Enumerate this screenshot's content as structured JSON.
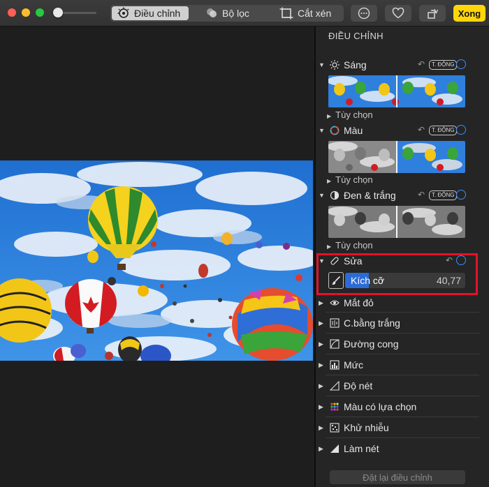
{
  "toolbar": {
    "tabs": [
      {
        "label": "Điều chỉnh",
        "icon": "adjust-dial-icon"
      },
      {
        "label": "Bộ lọc",
        "icon": "filters-circles-icon"
      },
      {
        "label": "Cắt xén",
        "icon": "crop-icon"
      }
    ],
    "more_icon": "ellipsis-icon",
    "favorite_icon": "heart-icon",
    "rotate_icon": "rotate-icon",
    "done_label": "Xong",
    "done_color": "#ffd60a"
  },
  "sidebar": {
    "title": "ĐIỀU CHỈNH",
    "sections": [
      {
        "label": "Sáng",
        "icon": "sun-icon",
        "auto": "T. ĐỘNG",
        "options": "Tùy chọn"
      },
      {
        "label": "Màu",
        "icon": "color-wheel-icon",
        "auto": "T. ĐỘNG",
        "options": "Tùy chọn"
      },
      {
        "label": "Đen & trắng",
        "icon": "half-circle-icon",
        "auto": "T. ĐỘNG",
        "options": "Tùy chọn"
      }
    ],
    "repair": {
      "label": "Sửa",
      "icon": "bandage-icon",
      "brush_icon": "brush-icon",
      "size_label": "Kích cỡ",
      "size_value": "40,77",
      "size_fraction": 0.2
    },
    "rows": [
      {
        "label": "Mắt đỏ",
        "icon": "eye-icon"
      },
      {
        "label": "C.bằng trắng",
        "icon": "white-balance-icon"
      },
      {
        "label": "Đường cong",
        "icon": "curves-icon"
      },
      {
        "label": "Mức",
        "icon": "levels-icon"
      },
      {
        "label": "Độ nét",
        "icon": "definition-icon"
      },
      {
        "label": "Màu có lựa chọn",
        "icon": "selective-color-icon"
      },
      {
        "label": "Khử nhiễu",
        "icon": "noise-reduction-icon"
      },
      {
        "label": "Làm nét",
        "icon": "sharpen-icon"
      }
    ],
    "reset_label": "Đặt lại điều chỉnh"
  },
  "colors": {
    "accent": "#3a8cff",
    "highlight": "#e3132a"
  }
}
